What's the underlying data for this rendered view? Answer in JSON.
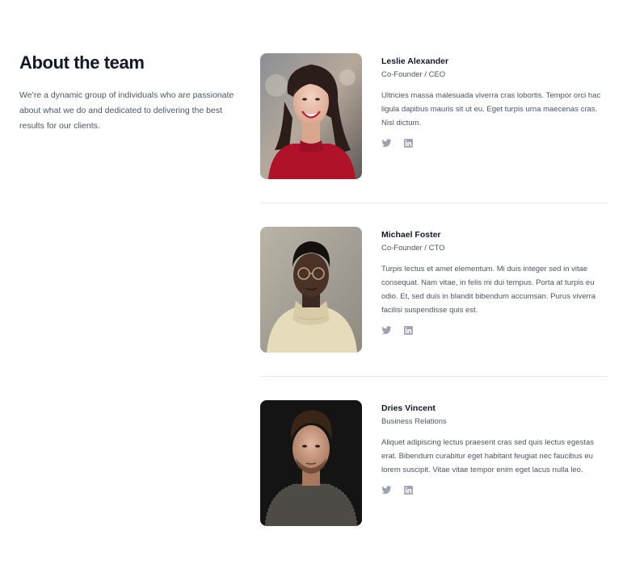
{
  "section": {
    "title": "About the team",
    "description": "We’re a dynamic group of individuals who are passionate about what we do and dedicated to delivering the best results for our clients."
  },
  "colors": {
    "heading": "#111827",
    "body_text": "#4b5563",
    "icon": "#9ca3af",
    "divider": "#e5e7eb"
  },
  "team": [
    {
      "name": "Leslie Alexander",
      "role": "Co-Founder / CEO",
      "bio": "Ultricies massa malesuada viverra cras lobortis. Tempor orci hac ligula dapibus mauris sit ut eu. Eget turpis urna maecenas cras. Nisl dictum.",
      "photo": "portrait-woman-red-sweater",
      "social": [
        {
          "icon": "twitter-icon",
          "label": "Twitter"
        },
        {
          "icon": "linkedin-icon",
          "label": "LinkedIn"
        }
      ]
    },
    {
      "name": "Michael Foster",
      "role": "Co-Founder / CTO",
      "bio": "Turpis lectus et amet elementum. Mi duis integer sed in vitae consequat. Nam vitae, in felis mi dui tempus. Porta at turpis eu odio. Et, sed duis in blandit bibendum accumsan. Purus viverra facilisi suspendisse quis est.",
      "photo": "portrait-man-glasses-turtleneck",
      "social": [
        {
          "icon": "twitter-icon",
          "label": "Twitter"
        },
        {
          "icon": "linkedin-icon",
          "label": "LinkedIn"
        }
      ]
    },
    {
      "name": "Dries Vincent",
      "role": "Business Relations",
      "bio": "Aliquet adipiscing lectus praesent cras sed quis lectus egestas erat. Bibendum curabitur eget habitant feugiat nec faucibus eu lorem suscipit. Vitae vitae tempor enim eget lacus nulla leo.",
      "photo": "portrait-man-dark-background",
      "social": [
        {
          "icon": "twitter-icon",
          "label": "Twitter"
        },
        {
          "icon": "linkedin-icon",
          "label": "LinkedIn"
        }
      ]
    }
  ]
}
